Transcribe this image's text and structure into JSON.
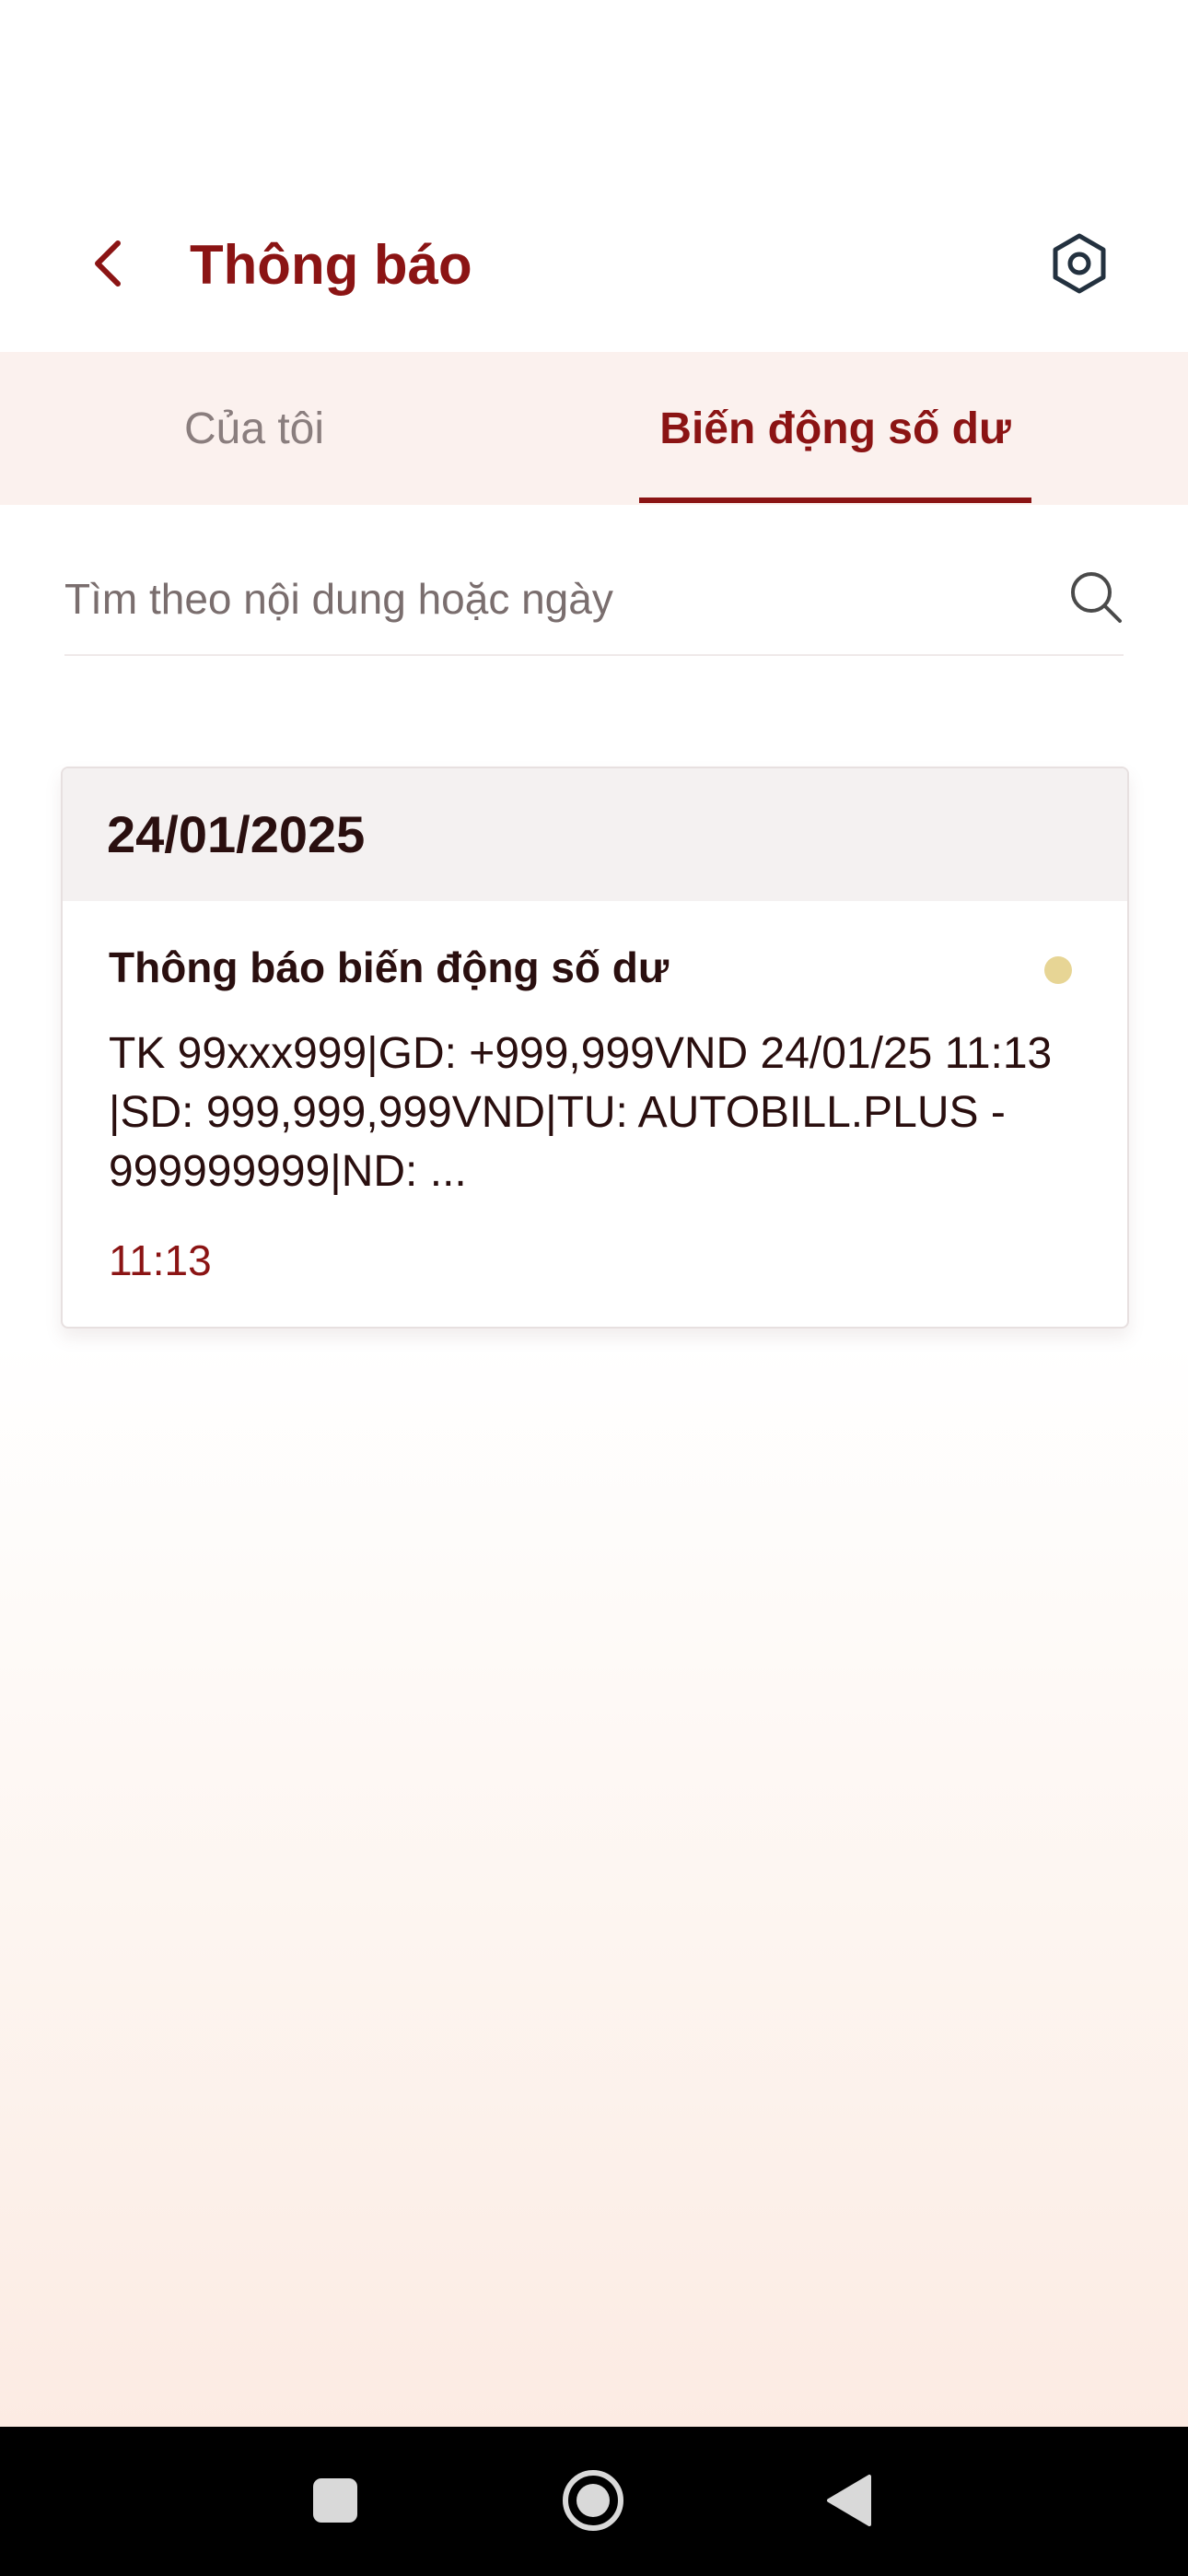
{
  "header": {
    "title": "Thông báo",
    "back_icon": "chevron-left-icon",
    "settings_icon": "settings-hexagon-icon"
  },
  "tabs": [
    {
      "label": "Của tôi",
      "active": false
    },
    {
      "label": "Biến động số dư",
      "active": true
    }
  ],
  "search": {
    "placeholder": "Tìm theo nội dung hoặc ngày",
    "value": "",
    "icon": "search-icon"
  },
  "notification_group": {
    "date": "24/01/2025",
    "items": [
      {
        "title": "Thông báo biến động số dư",
        "body": "TK 99xxx999|GD: +999,999VND 24/01/25 11:13 |SD: 999,999,999VND|TU: AUTOBILL.PLUS - 999999999|ND: ...",
        "time": "11:13",
        "unread": true
      }
    ]
  },
  "system_nav": {
    "buttons": [
      "recents-icon",
      "home-icon",
      "back-icon"
    ]
  },
  "colors": {
    "brand": "#8b1414",
    "tab_bar_bg": "#fbf1ee",
    "unread_dot": "#e7d595",
    "date_bar_bg": "#f4f1f1"
  }
}
